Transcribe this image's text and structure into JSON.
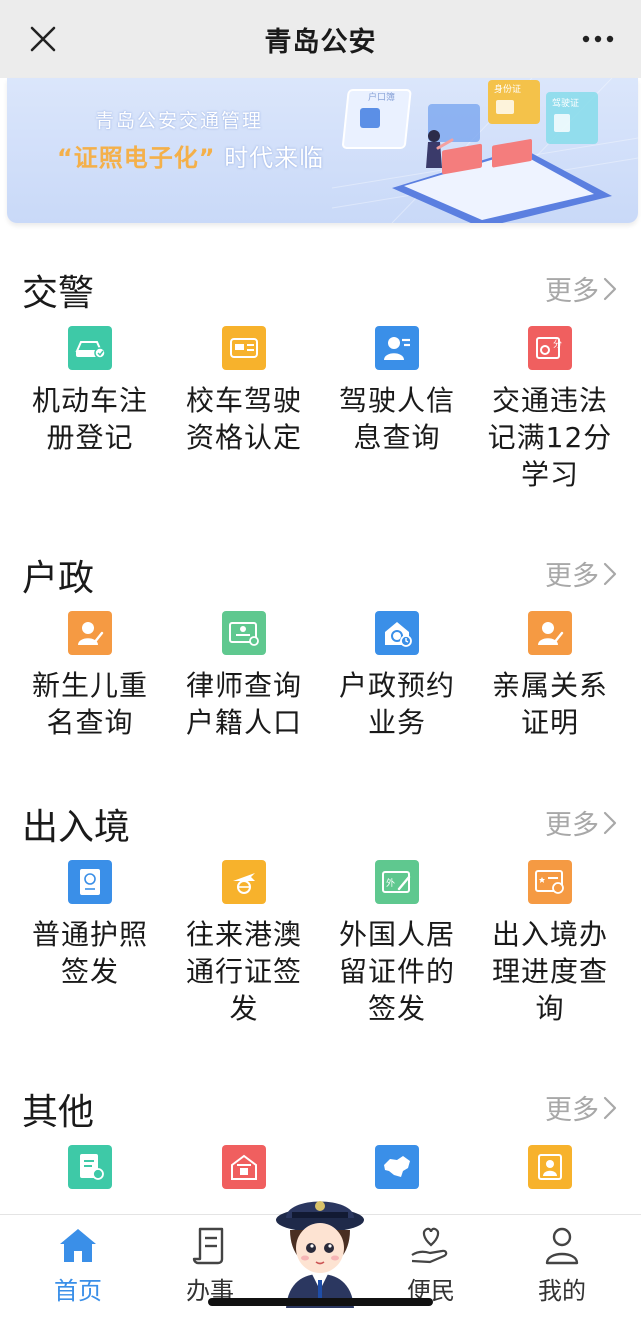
{
  "nav": {
    "title": "青岛公安"
  },
  "banner": {
    "subtitle": "青岛公安交通管理",
    "headline_highlight": "“证照电子化”",
    "headline_rest": "时代来临",
    "art_labels": [
      "户口簿",
      "身份证",
      "驾驶证"
    ]
  },
  "sections": [
    {
      "title": "交警",
      "more": "更多",
      "items": [
        {
          "label": "机动车注册登记",
          "icon": "car-register-icon",
          "color": "#3ec9a7"
        },
        {
          "label": "校车驾驶资格认定",
          "icon": "bus-license-icon",
          "color": "#f7b22c"
        },
        {
          "label": "驾驶人信息查询",
          "icon": "driver-info-icon",
          "color": "#3a8fe8"
        },
        {
          "label": "交通违法记满12分学习",
          "icon": "violation-points-icon",
          "color": "#f05f5f"
        }
      ]
    },
    {
      "title": "户政",
      "more": "更多",
      "items": [
        {
          "label": "新生儿重名查询",
          "icon": "newborn-name-icon",
          "color": "#f59a43"
        },
        {
          "label": "律师查询户籍人口",
          "icon": "lawyer-query-icon",
          "color": "#5fc88f"
        },
        {
          "label": "户政预约业务",
          "icon": "appointment-icon",
          "color": "#3a8fe8"
        },
        {
          "label": "亲属关系证明",
          "icon": "kinship-proof-icon",
          "color": "#f59a43"
        }
      ]
    },
    {
      "title": "出入境",
      "more": "更多",
      "items": [
        {
          "label": "普通护照签发",
          "icon": "passport-icon",
          "color": "#3a8fe8"
        },
        {
          "label": "往来港澳通行证签发",
          "icon": "hk-macao-pass-icon",
          "color": "#f7b22c"
        },
        {
          "label": "外国人居留证件的签发",
          "icon": "foreigner-permit-icon",
          "color": "#5fc88f"
        },
        {
          "label": "出入境办理进度查询",
          "icon": "progress-query-icon",
          "color": "#f59a43"
        }
      ]
    },
    {
      "title": "其他",
      "more": "更多",
      "items": [
        {
          "label": "",
          "icon": "document-icon",
          "color": "#3ec9a7"
        },
        {
          "label": "",
          "icon": "house-icon",
          "color": "#f05f5f"
        },
        {
          "label": "",
          "icon": "china-map-icon",
          "color": "#3a8fe8"
        },
        {
          "label": "",
          "icon": "frame-icon",
          "color": "#f7b22c"
        }
      ]
    }
  ],
  "tabs": [
    {
      "label": "首页",
      "icon": "home-icon",
      "active": true
    },
    {
      "label": "办事",
      "icon": "scroll-icon",
      "active": false
    },
    {
      "label": "便民",
      "icon": "hand-heart-icon",
      "active": false
    },
    {
      "label": "我的",
      "icon": "person-icon",
      "active": false
    }
  ],
  "colors": {
    "accent": "#3a8fe8",
    "more_text": "#a8a8a8",
    "navbar_bg": "#ececec"
  }
}
